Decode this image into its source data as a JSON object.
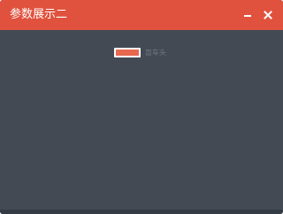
{
  "window": {
    "title": "参数展示二",
    "controls": {
      "minimize_icon": "minimize-icon",
      "close_icon": "close-icon"
    }
  },
  "chart_data": {
    "type": "line",
    "legend": [
      "盲车头"
    ],
    "series": [
      {
        "name": "盲车头",
        "values": [],
        "color": "#e8674f"
      }
    ],
    "legend_placement": "top-center"
  },
  "colors": {
    "titlebar": "#e0523e",
    "background": "#434a54",
    "accent": "#e8674f"
  }
}
